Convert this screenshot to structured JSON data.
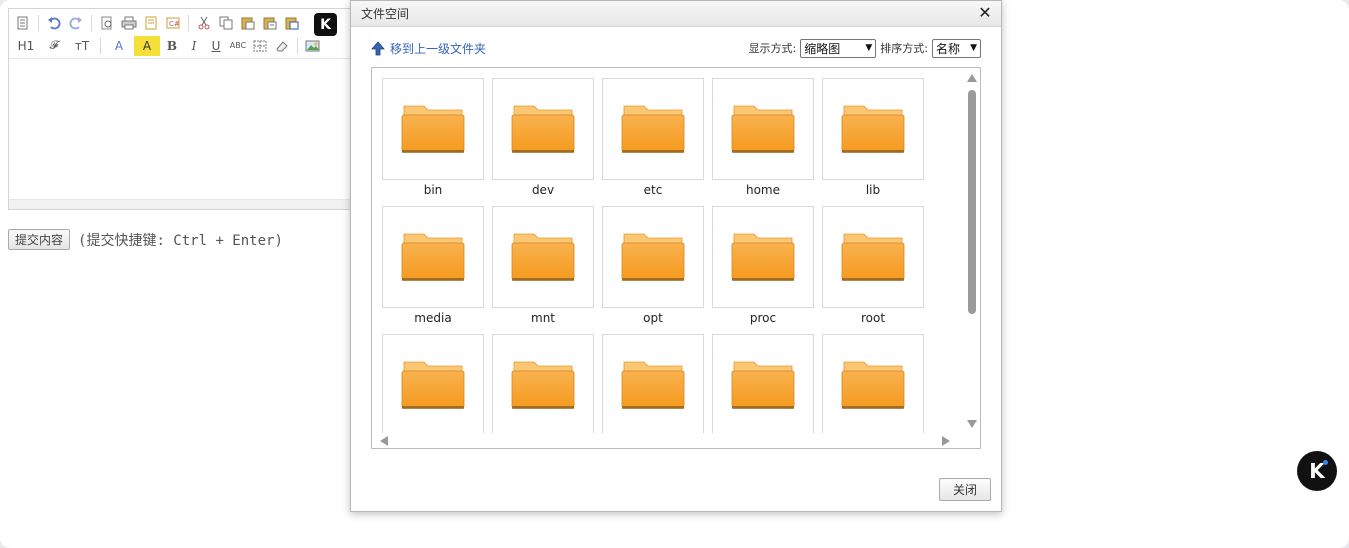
{
  "editor": {
    "toolbar_row1": [
      "source-icon",
      "undo-icon",
      "redo-icon",
      "preview-icon",
      "print-icon",
      "template-icon",
      "clean-icon",
      "cut-icon",
      "copy-icon",
      "paste-icon",
      "paste-text-icon",
      "paste-word-icon"
    ],
    "toolbar_row2": [
      "H1",
      "𝓕",
      "тT",
      "A",
      "A",
      "B",
      "I",
      "U",
      "ABC",
      "strike",
      "eraser",
      "image"
    ],
    "submit_label": "提交内容",
    "submit_hint": "(提交快捷键: Ctrl + Enter)"
  },
  "dialog": {
    "title": "文件空间",
    "close_glyph": "✕",
    "up_link": "移到上一级文件夹",
    "view_label": "显示方式:",
    "view_value": "缩略图",
    "sort_label": "排序方式:",
    "sort_value": "名称",
    "close_button": "关闭",
    "folders": [
      "bin",
      "dev",
      "etc",
      "home",
      "lib",
      "media",
      "mnt",
      "opt",
      "proc",
      "root",
      "",
      "",
      "",
      "",
      ""
    ]
  },
  "colors": {
    "folder_top": "#f9b24f",
    "folder_body": "#f59a1e",
    "link": "#3366bb",
    "badge": "#111111"
  }
}
